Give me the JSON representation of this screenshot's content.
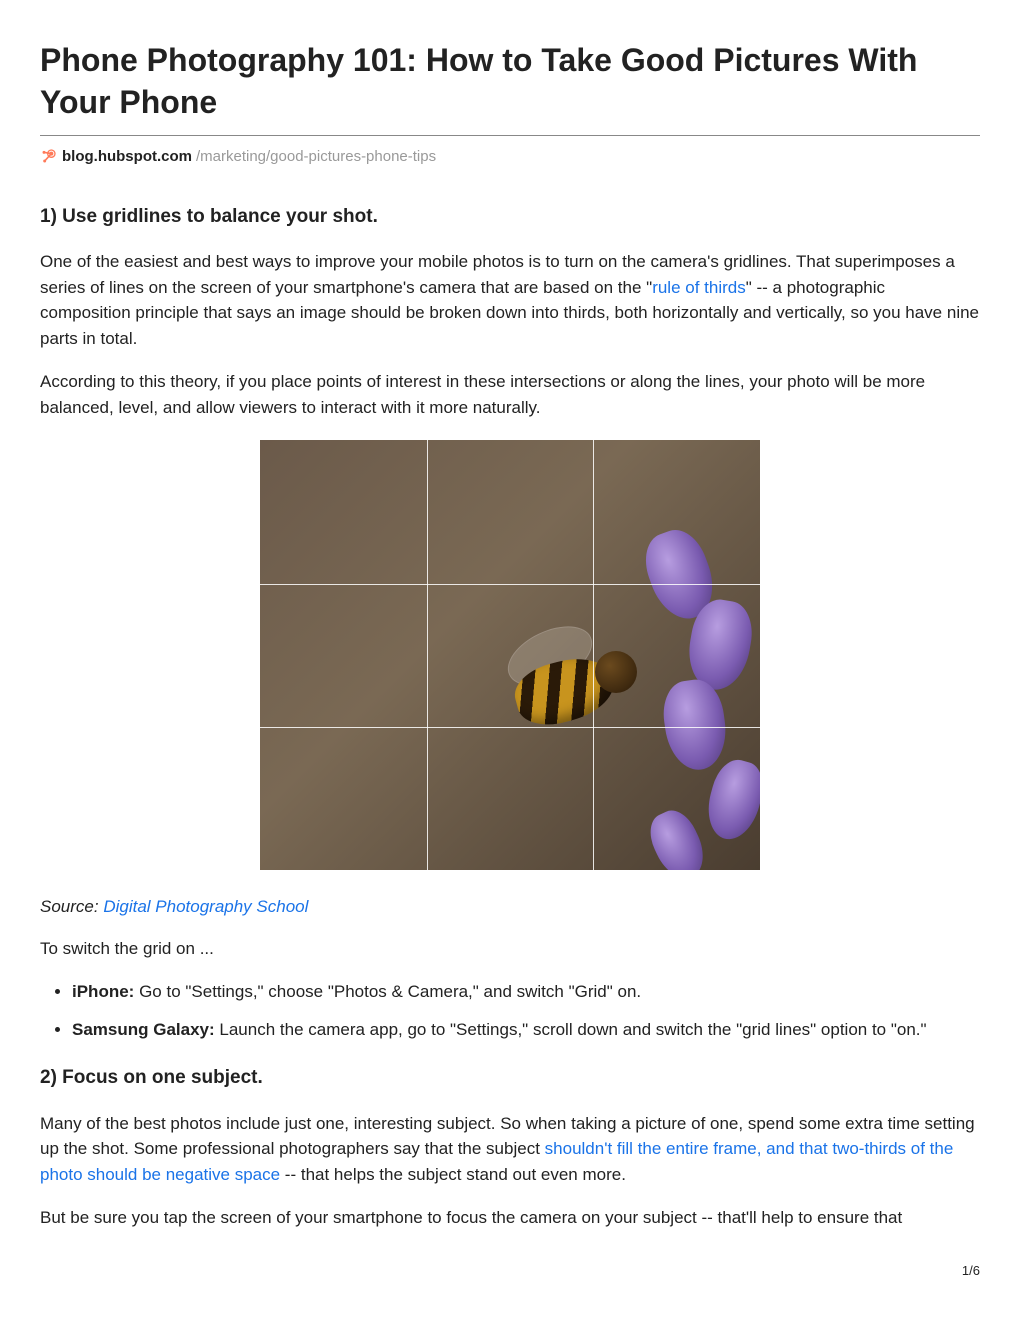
{
  "title": "Phone Photography 101: How to Take Good Pictures With Your Phone",
  "source": {
    "domain": "blog.hubspot.com",
    "path": "/marketing/good-pictures-phone-tips"
  },
  "sections": [
    {
      "heading": "1) Use gridlines to balance your shot.",
      "para1_a": "One of the easiest and best ways to improve your mobile photos is to turn on the camera's gridlines. That superimposes a series of lines on the screen of your smartphone's camera that are based on the \"",
      "para1_link": "rule of thirds",
      "para1_b": "\" -- a photographic composition principle that says an image should be broken down into thirds, both horizontally and vertically, so you have nine parts in total.",
      "para2": "According to this theory, if you place points of interest in these intersections or along the lines, your photo will be more balanced, level, and allow viewers to interact with it more naturally.",
      "caption_prefix": "Source: ",
      "caption_link": "Digital Photography School",
      "switch_intro": "To switch the grid on ...",
      "list": [
        {
          "label": "iPhone:",
          "text": " Go to \"Settings,\" choose \"Photos & Camera,\" and switch \"Grid\" on."
        },
        {
          "label": "Samsung Galaxy:",
          "text": " Launch the camera app, go to \"Settings,\" scroll down and switch the \"grid lines\" option to \"on.\""
        }
      ]
    },
    {
      "heading": "2) Focus on one subject.",
      "para1_a": "Many of the best photos include just one, interesting subject. So when taking a picture of one, spend some extra time setting up the shot. Some professional photographers say that the subject ",
      "para1_link": "shouldn't fill the entire frame, and that two-thirds of the photo should be negative space",
      "para1_b": " -- that helps the subject stand out even more.",
      "para2": "But be sure you tap the screen of your smartphone to focus the camera on your subject -- that'll help to ensure that"
    }
  ],
  "page_number": "1/6"
}
